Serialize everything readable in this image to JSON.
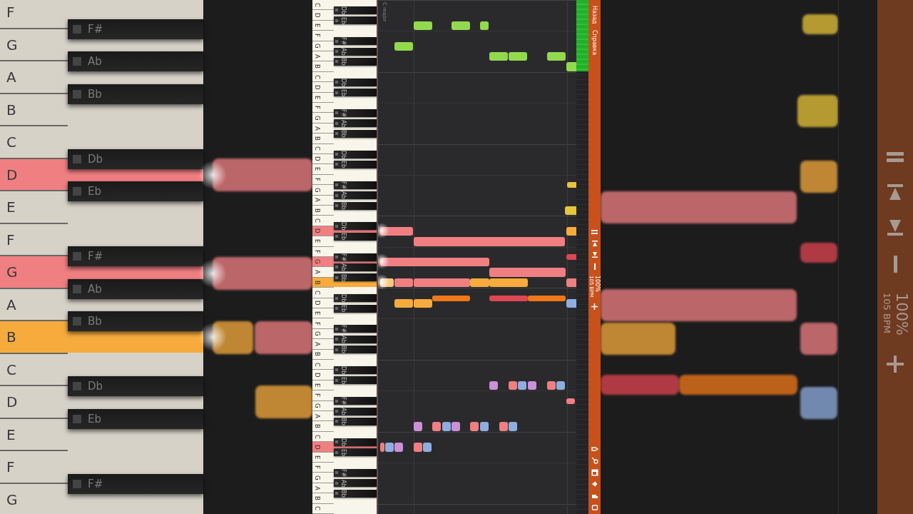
{
  "backdrop_left": {
    "white_keys": [
      {
        "label": "F",
        "pressed": false
      },
      {
        "label": "G",
        "pressed": false
      },
      {
        "label": "A",
        "pressed": false
      },
      {
        "label": "B",
        "pressed": false
      },
      {
        "label": "C",
        "pressed": false
      },
      {
        "label": "D",
        "pressed": true,
        "color": "#f07f82"
      },
      {
        "label": "E",
        "pressed": false
      },
      {
        "label": "F",
        "pressed": false
      },
      {
        "label": "G",
        "pressed": true,
        "color": "#f07f82"
      },
      {
        "label": "A",
        "pressed": false
      },
      {
        "label": "B",
        "pressed": true,
        "color": "#f6ab3c"
      },
      {
        "label": "C",
        "pressed": false
      },
      {
        "label": "D",
        "pressed": false
      },
      {
        "label": "E",
        "pressed": false
      },
      {
        "label": "F",
        "pressed": false
      },
      {
        "label": "G",
        "pressed": false
      }
    ],
    "black_keys": [
      "F#",
      "Ab",
      "Bb",
      "Db",
      "Eb",
      "F#",
      "Ab",
      "Bb",
      "Db",
      "Eb",
      "F#"
    ]
  },
  "keyboard": {
    "white_keys": [
      {
        "label": "C",
        "pressed": false
      },
      {
        "label": "D",
        "pressed": false
      },
      {
        "label": "E",
        "pressed": false
      },
      {
        "label": "F",
        "pressed": false
      },
      {
        "label": "G",
        "pressed": false
      },
      {
        "label": "A",
        "pressed": false
      },
      {
        "label": "B",
        "pressed": false
      },
      {
        "label": "C",
        "pressed": false
      },
      {
        "label": "D",
        "pressed": false
      },
      {
        "label": "E",
        "pressed": false
      },
      {
        "label": "F",
        "pressed": false
      },
      {
        "label": "G",
        "pressed": false
      },
      {
        "label": "A",
        "pressed": false
      },
      {
        "label": "B",
        "pressed": false
      },
      {
        "label": "C",
        "pressed": false
      },
      {
        "label": "D",
        "pressed": false
      },
      {
        "label": "E",
        "pressed": false
      },
      {
        "label": "F",
        "pressed": false
      },
      {
        "label": "G",
        "pressed": false
      },
      {
        "label": "A",
        "pressed": false
      },
      {
        "label": "B",
        "pressed": false
      },
      {
        "label": "C",
        "pressed": false
      },
      {
        "label": "D",
        "pressed": true,
        "color": "#f07f82"
      },
      {
        "label": "E",
        "pressed": false
      },
      {
        "label": "F",
        "pressed": false
      },
      {
        "label": "G",
        "pressed": true,
        "color": "#f07f82"
      },
      {
        "label": "A",
        "pressed": false
      },
      {
        "label": "B",
        "pressed": true,
        "color": "#f6ab3c"
      },
      {
        "label": "C",
        "pressed": false
      },
      {
        "label": "D",
        "pressed": false
      },
      {
        "label": "E",
        "pressed": false
      },
      {
        "label": "F",
        "pressed": false
      },
      {
        "label": "G",
        "pressed": false
      },
      {
        "label": "A",
        "pressed": false
      },
      {
        "label": "B",
        "pressed": false
      },
      {
        "label": "C",
        "pressed": false
      },
      {
        "label": "D",
        "pressed": false
      },
      {
        "label": "E",
        "pressed": false
      },
      {
        "label": "F",
        "pressed": false
      },
      {
        "label": "G",
        "pressed": false
      },
      {
        "label": "A",
        "pressed": false
      },
      {
        "label": "B",
        "pressed": false
      },
      {
        "label": "C",
        "pressed": false
      },
      {
        "label": "D",
        "pressed": true,
        "color": "#f07f82"
      },
      {
        "label": "E",
        "pressed": false
      },
      {
        "label": "F",
        "pressed": false
      },
      {
        "label": "G",
        "pressed": false
      },
      {
        "label": "A",
        "pressed": false
      },
      {
        "label": "B",
        "pressed": false
      },
      {
        "label": "C",
        "pressed": false
      }
    ],
    "black_keys": [
      "Db",
      "Eb",
      "F#",
      "Ab",
      "Bb",
      "Db",
      "Eb",
      "F#",
      "Ab",
      "Bb",
      "Db",
      "Eb",
      "F#",
      "Ab",
      "Bb",
      "Db",
      "Eb",
      "F#",
      "Ab",
      "Bb",
      "Db",
      "Eb",
      "F#",
      "Ab",
      "Bb",
      "Db",
      "Eb",
      "F#",
      "Ab",
      "Bb",
      "Db",
      "Eb",
      "F#",
      "Ab",
      "Bb"
    ]
  },
  "roll": {
    "key_signature": "C major"
  },
  "sidebar": {
    "menu": [
      {
        "label": "Назад"
      },
      {
        "label": "Справка"
      }
    ],
    "tempo": "100%",
    "bpm": "105 BPM"
  },
  "backdrop_right": {
    "tempo": "100%",
    "bpm": "105 BPM"
  }
}
